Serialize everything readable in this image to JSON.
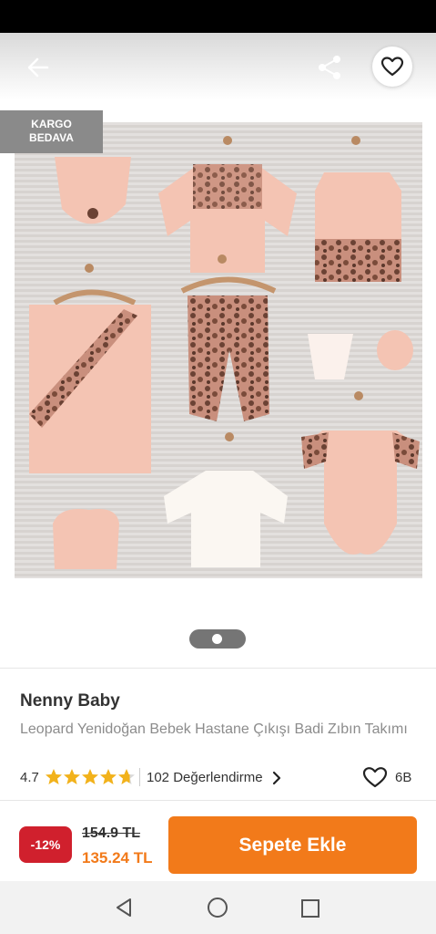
{
  "header": {
    "back_icon": "arrow-left-icon",
    "share_icon": "share-icon",
    "favorite_icon": "heart-outline-icon"
  },
  "gallery": {
    "badge_line1": "KARGO",
    "badge_line2": "BEDAVA",
    "pager_pages": 1,
    "pager_active": 1
  },
  "product": {
    "brand": "Nenny Baby",
    "name": "Leopard Yenidoğan Bebek Hastane Çıkışı Badi Zıbın Takımı",
    "rating": "4.7",
    "rating_value": 4.7,
    "reviews_label": "102 Değerlendirme",
    "favorite_count": "6B"
  },
  "purchase": {
    "discount": "-12%",
    "old_price": "154.9 TL",
    "new_price": "135.24 TL",
    "add_to_cart": "Sepete Ekle"
  },
  "colors": {
    "accent": "#f27a1a",
    "discount": "#d0202d",
    "star": "#f2b21b",
    "badge": "#8a8a8a"
  },
  "system_nav": {
    "back_icon": "nav-back-icon",
    "home_icon": "nav-home-icon",
    "recents_icon": "nav-recents-icon"
  }
}
